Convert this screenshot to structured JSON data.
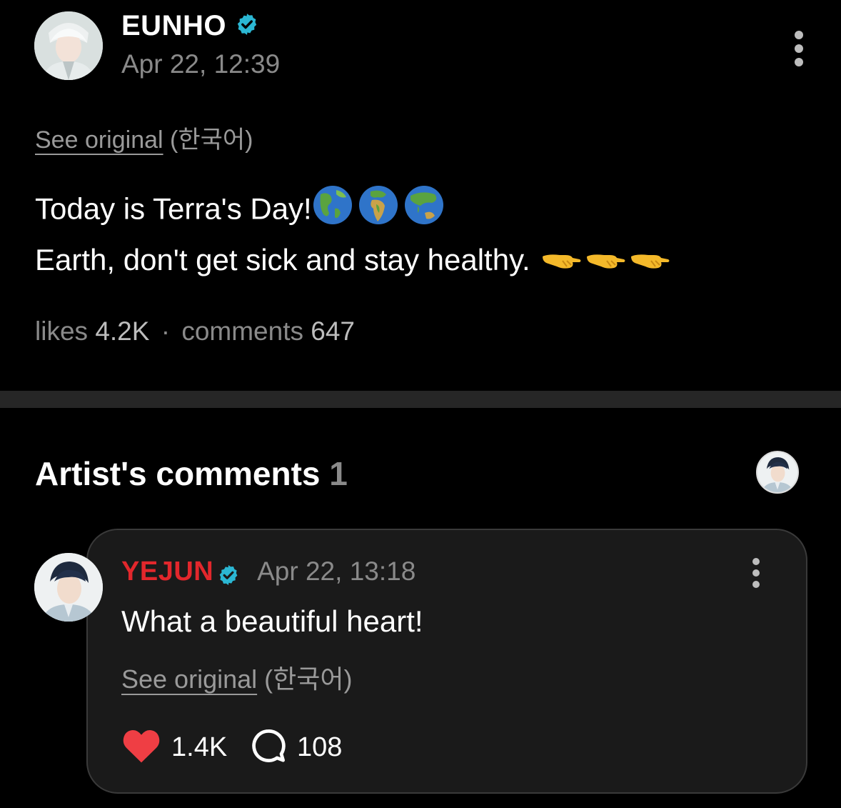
{
  "post": {
    "author": "EUNHO",
    "timestamp": "Apr 22, 12:39",
    "see_original_link": "See original",
    "see_original_lang": "(한국어)",
    "line1": "Today is Terra's Day!",
    "line2": "Earth, don't get sick and stay healthy.",
    "line1_emojis": [
      "globe-americas-icon",
      "globe-europe-africa-icon",
      "globe-asia-australia-icon"
    ],
    "line2_emojis": [
      "hand-pointing-icon",
      "hand-pointing-icon",
      "hand-pointing-icon"
    ],
    "likes_label": "likes",
    "likes_count": "4.2K",
    "separator": "·",
    "comments_label": "comments",
    "comments_count": "647"
  },
  "artist_comments": {
    "title": "Artist's comments",
    "count": "1"
  },
  "comment": {
    "author": "YEJUN",
    "timestamp": "Apr 22, 13:18",
    "text": "What a beautiful heart!",
    "see_original_link": "See original",
    "see_original_lang": "(한국어)",
    "likes": "1.4K",
    "replies": "108"
  },
  "colors": {
    "background": "#000000",
    "verified_badge": "#2bb7d3",
    "comment_author": "#e2272c",
    "heart": "#ef3e44",
    "muted_text": "#8a8a8a"
  }
}
